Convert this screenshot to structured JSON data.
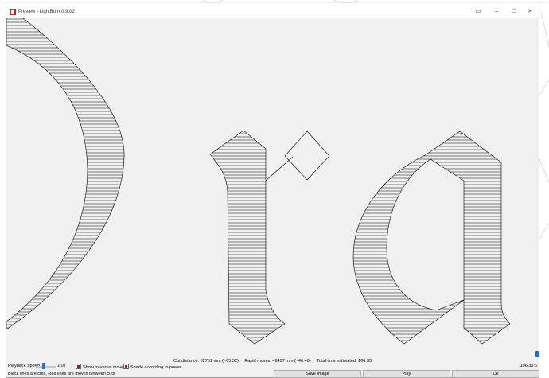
{
  "window": {
    "title": "Preview - LightBurn 0.9.02",
    "controls": {
      "restore_icon": "restore-icon",
      "minimize": "–",
      "maximize": "☐",
      "close": "✕"
    }
  },
  "stats": {
    "cut_distance": "Cut distance: 82751 mm (~65:52)",
    "rapid_moves": "Rapid moves: 49497 mm (~40:40)",
    "total_time": "Total time estimated: 106:33"
  },
  "playback": {
    "label": "Playback Speed",
    "speed": "1.0x",
    "speed_fraction": 0.5,
    "timeline_position": "106:33:6",
    "timeline_fraction": 1.0
  },
  "options": {
    "show_traversal": "Show traversal moves",
    "shade_power": "Shade according to power"
  },
  "help_text": "Black lines are cuts, Red lines are moves between cuts",
  "buttons": {
    "save_image": "Save Image",
    "play": "Play",
    "ok": "Ok"
  },
  "colors": {
    "accent": "#1e6fd0",
    "cut_line": "#000000",
    "brand": "#c0272d"
  }
}
